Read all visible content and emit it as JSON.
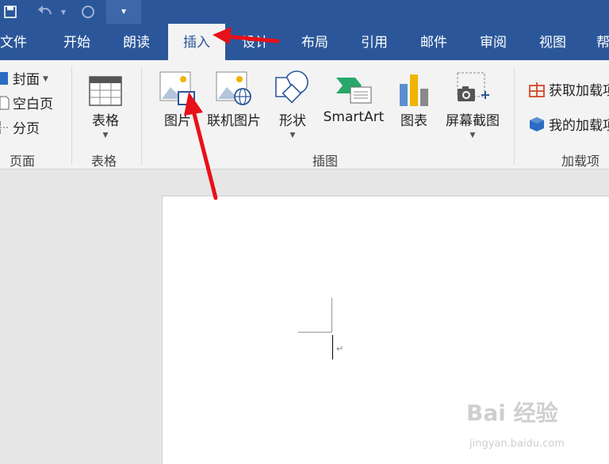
{
  "tabs": [
    {
      "label": "文件"
    },
    {
      "label": "开始"
    },
    {
      "label": "朗读"
    },
    {
      "label": "插入"
    },
    {
      "label": "设计"
    },
    {
      "label": "布局"
    },
    {
      "label": "引用"
    },
    {
      "label": "邮件"
    },
    {
      "label": "审阅"
    },
    {
      "label": "视图"
    },
    {
      "label": "帮"
    }
  ],
  "active_tab": "插入",
  "ribbon": {
    "pages": {
      "label": "页面",
      "cover": "封面",
      "blank": "空白页",
      "break": "分页"
    },
    "tables": {
      "label": "表格",
      "table": "表格"
    },
    "illustrations": {
      "label": "插图",
      "picture": "图片",
      "online_picture": "联机图片",
      "shapes": "形状",
      "smartart": "SmartArt",
      "chart": "图表",
      "screenshot": "屏幕截图"
    },
    "addins": {
      "label": "加载项",
      "get": "获取加载项",
      "mine": "我的加载项"
    }
  },
  "document": {
    "paragraph_mark": "↵"
  },
  "watermark": {
    "text": "Bai 经验",
    "url": "jingyan.baidu.com"
  },
  "colors": {
    "brand": "#2b579a",
    "ribbon_bg": "#f3f3f3",
    "arrow": "#e8101a"
  }
}
